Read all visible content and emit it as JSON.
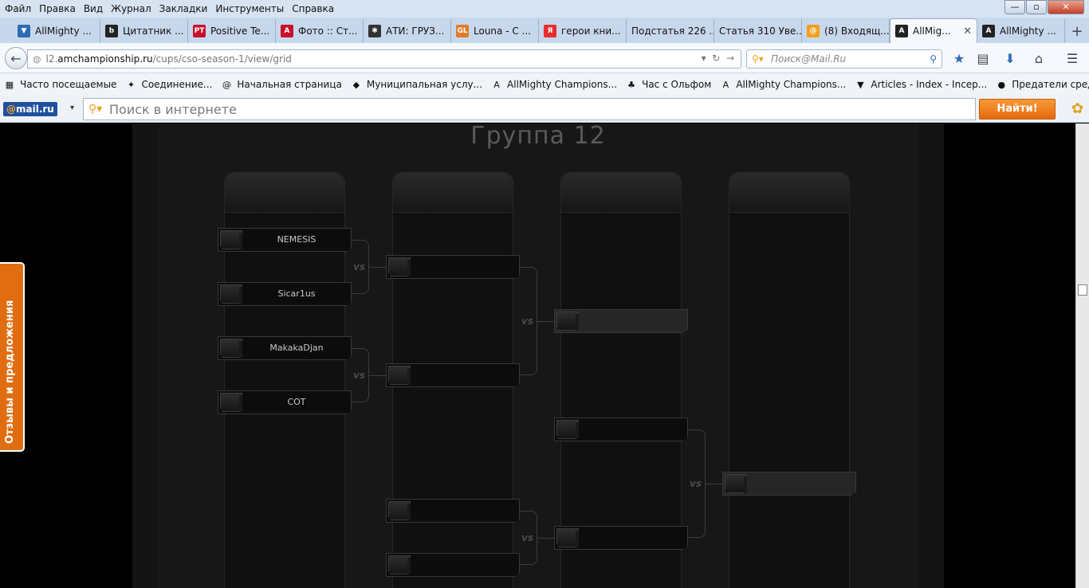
{
  "menu": [
    "Файл",
    "Правка",
    "Вид",
    "Журнал",
    "Закладки",
    "Инструменты",
    "Справка"
  ],
  "tabs": [
    {
      "label": "AllMighty ...",
      "icon": "allmighty-icon",
      "color": "#2d6bb5",
      "glyph": "▼"
    },
    {
      "label": "Цитатник ...",
      "icon": "bash-icon",
      "color": "#222",
      "glyph": "b"
    },
    {
      "label": "Positive Te...",
      "icon": "pt-icon",
      "color": "#c8102e",
      "glyph": "PT"
    },
    {
      "label": "Фото :: Ст...",
      "icon": "photo-icon",
      "color": "#c8102e",
      "glyph": "A"
    },
    {
      "label": "АТИ: ГРУЗ...",
      "icon": "ati-icon",
      "color": "#333",
      "glyph": "✱"
    },
    {
      "label": "Louna - С ...",
      "icon": "gl-icon",
      "color": "#e07b2a",
      "glyph": "GL"
    },
    {
      "label": "герои кни...",
      "icon": "yandex-icon",
      "color": "#e62e2e",
      "glyph": "Я"
    },
    {
      "label": "Подстатья 226 ...",
      "icon": "",
      "color": "",
      "glyph": ""
    },
    {
      "label": "Статья 310 Уве...",
      "icon": "",
      "color": "",
      "glyph": ""
    },
    {
      "label": "(8) Входящ...",
      "icon": "mail-icon",
      "color": "#f0a020",
      "glyph": "@"
    },
    {
      "label": "AllMig...",
      "icon": "allmighty-a-icon",
      "color": "#222",
      "glyph": "A",
      "active": true
    },
    {
      "label": "AllMighty ...",
      "icon": "allmighty-a-icon",
      "color": "#222",
      "glyph": "A"
    }
  ],
  "url": {
    "prefix": "l2.",
    "domain": "amchampionship.ru",
    "path": "/cups/cso-season-1/view/grid"
  },
  "search_placeholder": "Поиск@Mail.Ru",
  "bookmarks": [
    {
      "label": "Часто посещаемые",
      "glyph": "▦"
    },
    {
      "label": "Соединение...",
      "glyph": "✦"
    },
    {
      "label": "Начальная страница",
      "glyph": "@"
    },
    {
      "label": "Муниципальная услу...",
      "glyph": "◆"
    },
    {
      "label": "AllMighty Champions...",
      "glyph": "A"
    },
    {
      "label": "Час с Ольфом",
      "glyph": "♣"
    },
    {
      "label": "AllMighty Champions...",
      "glyph": "A"
    },
    {
      "label": "Articles - Index - Incep...",
      "glyph": "▼"
    },
    {
      "label": "Предатели среди вас!",
      "glyph": "●"
    }
  ],
  "mail": {
    "logo_at": "@",
    "logo_text": "mail.ru",
    "placeholder": "Поиск в интернете",
    "button": "Найти!"
  },
  "bracket": {
    "title": "Группа 12",
    "vs": "vs",
    "round1": [
      "NEMESIS",
      "Sicar1us",
      "MakakaDjan",
      "COT"
    ]
  },
  "feedback": "Отзывы и предложения"
}
